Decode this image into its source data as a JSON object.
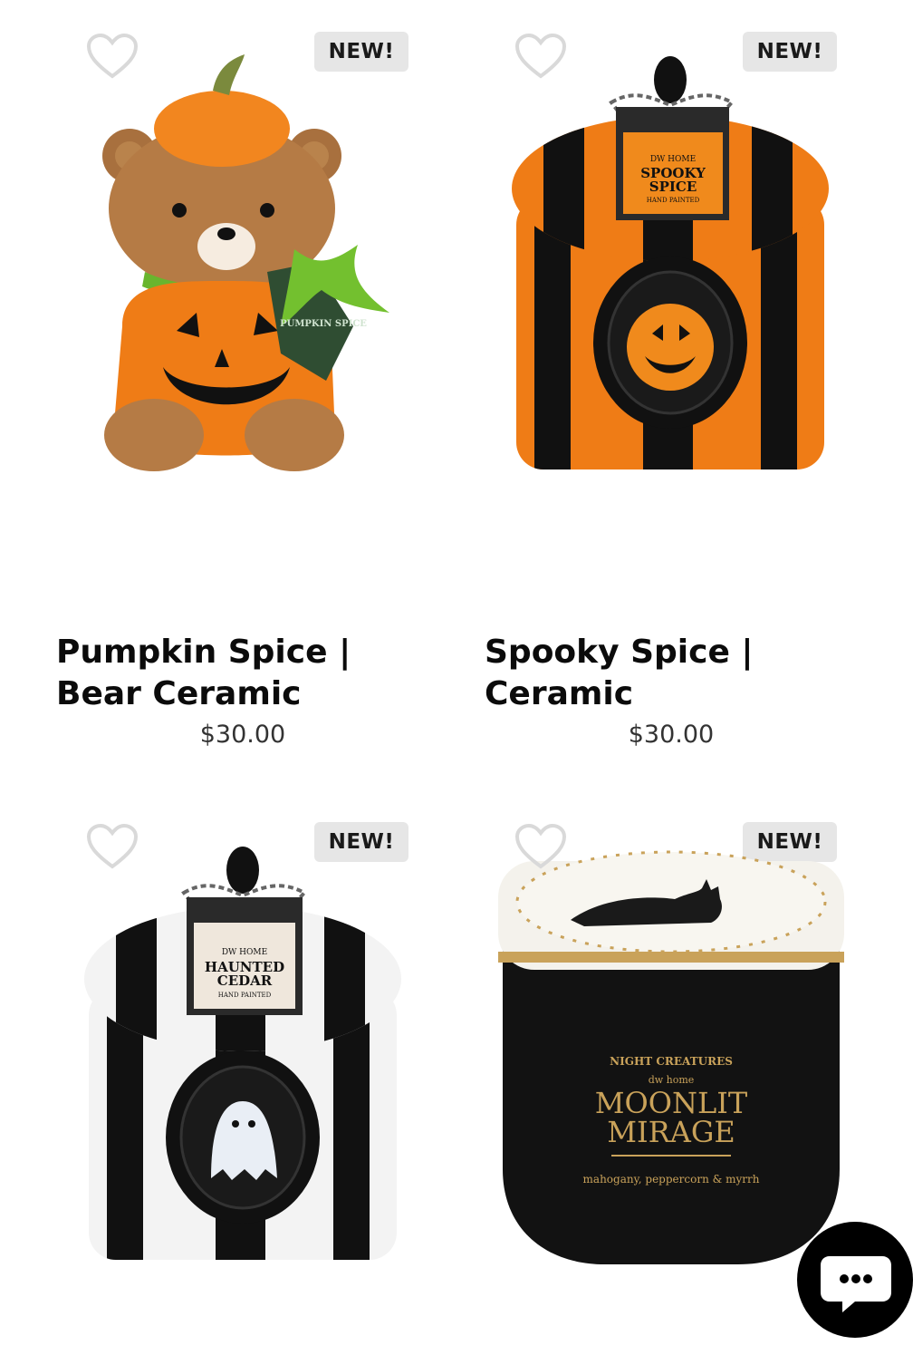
{
  "products": [
    {
      "badge": "NEW!",
      "title": "Pumpkin Spice | Bear Ceramic",
      "price": "$30.00",
      "image": "pumpkin-spice-bear-ceramic-candle",
      "tag_text": "PUMPKIN SPICE"
    },
    {
      "badge": "NEW!",
      "title": "Spooky Spice | Ceramic",
      "price": "$30.00",
      "image": "spooky-spice-ceramic-candle",
      "tag_text": [
        "DW HOME",
        "SPOOKY",
        "SPICE",
        "HAND PAINTED"
      ]
    },
    {
      "badge": "NEW!",
      "title": "",
      "price": "",
      "image": "haunted-cedar-ceramic-candle",
      "tag_text": [
        "DW HOME",
        "HAUNTED",
        "CEDAR",
        "HAND PAINTED"
      ]
    },
    {
      "badge": "NEW!",
      "title": "",
      "price": "",
      "image": "moonlit-mirage-candle",
      "label_text": [
        "NIGHT CREATURES",
        "dw home",
        "MOONLIT",
        "MIRAGE",
        "mahogany, peppercorn & myrrh"
      ]
    }
  ],
  "icons": {
    "wishlist": "heart-outline-icon",
    "chat": "chat-bubble-icon"
  },
  "colors": {
    "orange": "#f08a1c",
    "black": "#111111",
    "badge_bg": "#e6e6e6",
    "gold": "#c9a25a"
  }
}
